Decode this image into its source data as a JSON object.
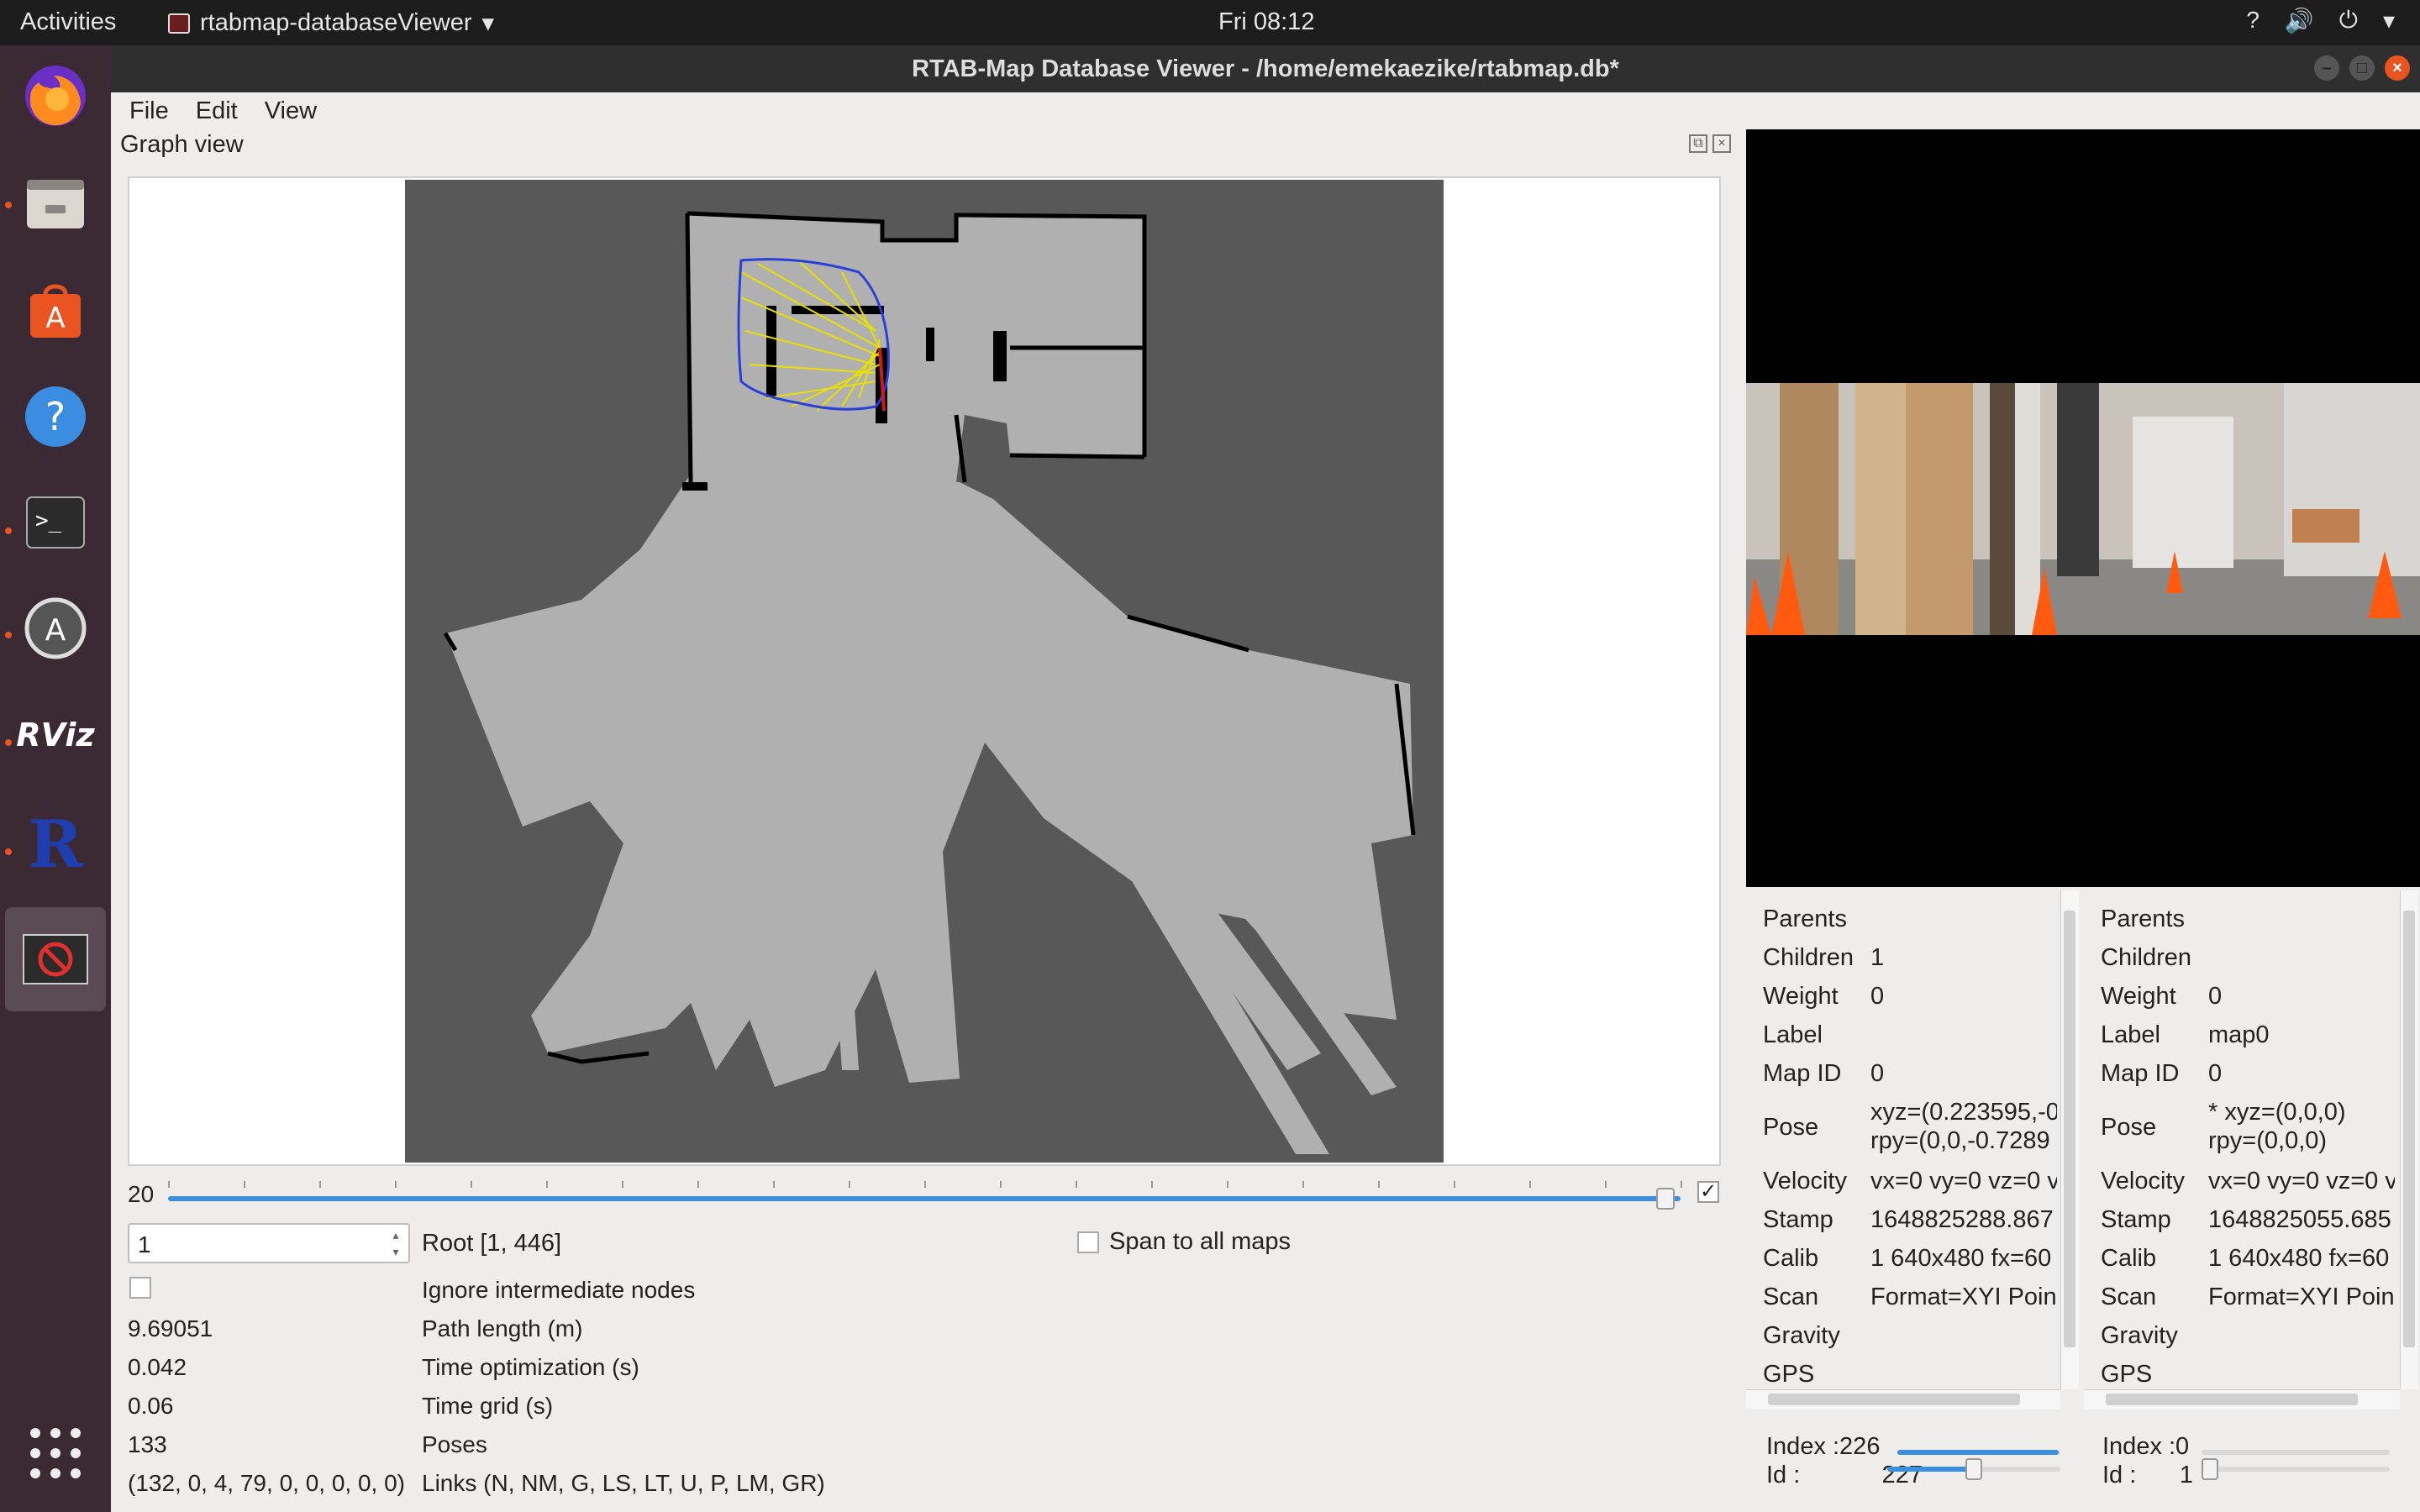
{
  "topbar": {
    "activities": "Activities",
    "app_name": "rtabmap-databaseViewer",
    "clock": "Fri 08:12"
  },
  "dock": {
    "items": [
      "firefox-icon",
      "files-icon",
      "software-icon",
      "help-icon",
      "terminal-icon",
      "updater-icon",
      "rviz-icon",
      "r-icon",
      "database-viewer-icon"
    ]
  },
  "window": {
    "title": "RTAB-Map Database Viewer - /home/emekaezike/rtabmap.db*"
  },
  "menu": {
    "file": "File",
    "edit": "Edit",
    "view": "View"
  },
  "graph": {
    "dock_title": "Graph view",
    "slider_value": "20",
    "slider_fraction": 0.99,
    "slider_checked": "✓",
    "node_id": "1",
    "root_label": "Root [1, 446]",
    "span_label": "Span to all maps",
    "ignore_label": "Ignore intermediate nodes",
    "stats": [
      {
        "value": "",
        "label": ""
      },
      {
        "value": "9.69051",
        "label": "Path length (m)"
      },
      {
        "value": "0.042",
        "label": "Time optimization (s)"
      },
      {
        "value": "0.06",
        "label": "Time grid (s)"
      },
      {
        "value": "133",
        "label": "Poses"
      },
      {
        "value": "(132, 0, 4, 79, 0, 0, 0, 0, 0)",
        "label": "Links (N, NM, G, LS, LT, U, P, LM, GR)"
      }
    ]
  },
  "left_info": {
    "rows": [
      {
        "key": "Parents",
        "value": ""
      },
      {
        "key": "Children",
        "value": "1"
      },
      {
        "key": "Weight",
        "value": "0"
      },
      {
        "key": "Label",
        "value": ""
      },
      {
        "key": "Map ID",
        "value": "0"
      },
      {
        "key": "Pose",
        "value": "xyz=(0.223595,-0",
        "value2": "rpy=(0,0,-0.7289"
      },
      {
        "key": "Velocity",
        "value": "vx=0 vy=0 vz=0 v"
      },
      {
        "key": "Stamp",
        "value": "1648825288.867"
      },
      {
        "key": "Calib",
        "value": "1 640x480 fx=60"
      },
      {
        "key": "Scan",
        "value": "Format=XYI Poin"
      },
      {
        "key": "Gravity",
        "value": ""
      },
      {
        "key": "GPS",
        "value": ""
      }
    ],
    "index_label": "Index :226",
    "id_label": "Id :",
    "id_value": "227",
    "index_fraction": 0.99,
    "id_fraction": 0.5
  },
  "right_info": {
    "rows": [
      {
        "key": "Parents",
        "value": ""
      },
      {
        "key": "Children",
        "value": ""
      },
      {
        "key": "Weight",
        "value": "0"
      },
      {
        "key": "Label",
        "value": "map0"
      },
      {
        "key": "Map ID",
        "value": "0"
      },
      {
        "key": "Pose",
        "value": "* xyz=(0,0,0)",
        "value2": "rpy=(0,0,0)"
      },
      {
        "key": "Velocity",
        "value": "vx=0 vy=0 vz=0 v"
      },
      {
        "key": "Stamp",
        "value": "1648825055.685"
      },
      {
        "key": "Calib",
        "value": "1 640x480 fx=60"
      },
      {
        "key": "Scan",
        "value": "Format=XYI Poin"
      },
      {
        "key": "Gravity",
        "value": ""
      },
      {
        "key": "GPS",
        "value": ""
      }
    ],
    "index_label": "Index :0",
    "id_label": "Id :",
    "id_value": "1",
    "index_fraction": 0.0,
    "id_fraction": 0.0
  },
  "colors": {
    "accent": "#e95420",
    "slider": "#3c8fd8",
    "map_unknown": "#585858",
    "map_free": "#b0b0b0",
    "map_occupied": "#000000",
    "graph_path": "#2a3fd8",
    "graph_links": "#e8e000",
    "loop_closure": "#d01a1a"
  }
}
